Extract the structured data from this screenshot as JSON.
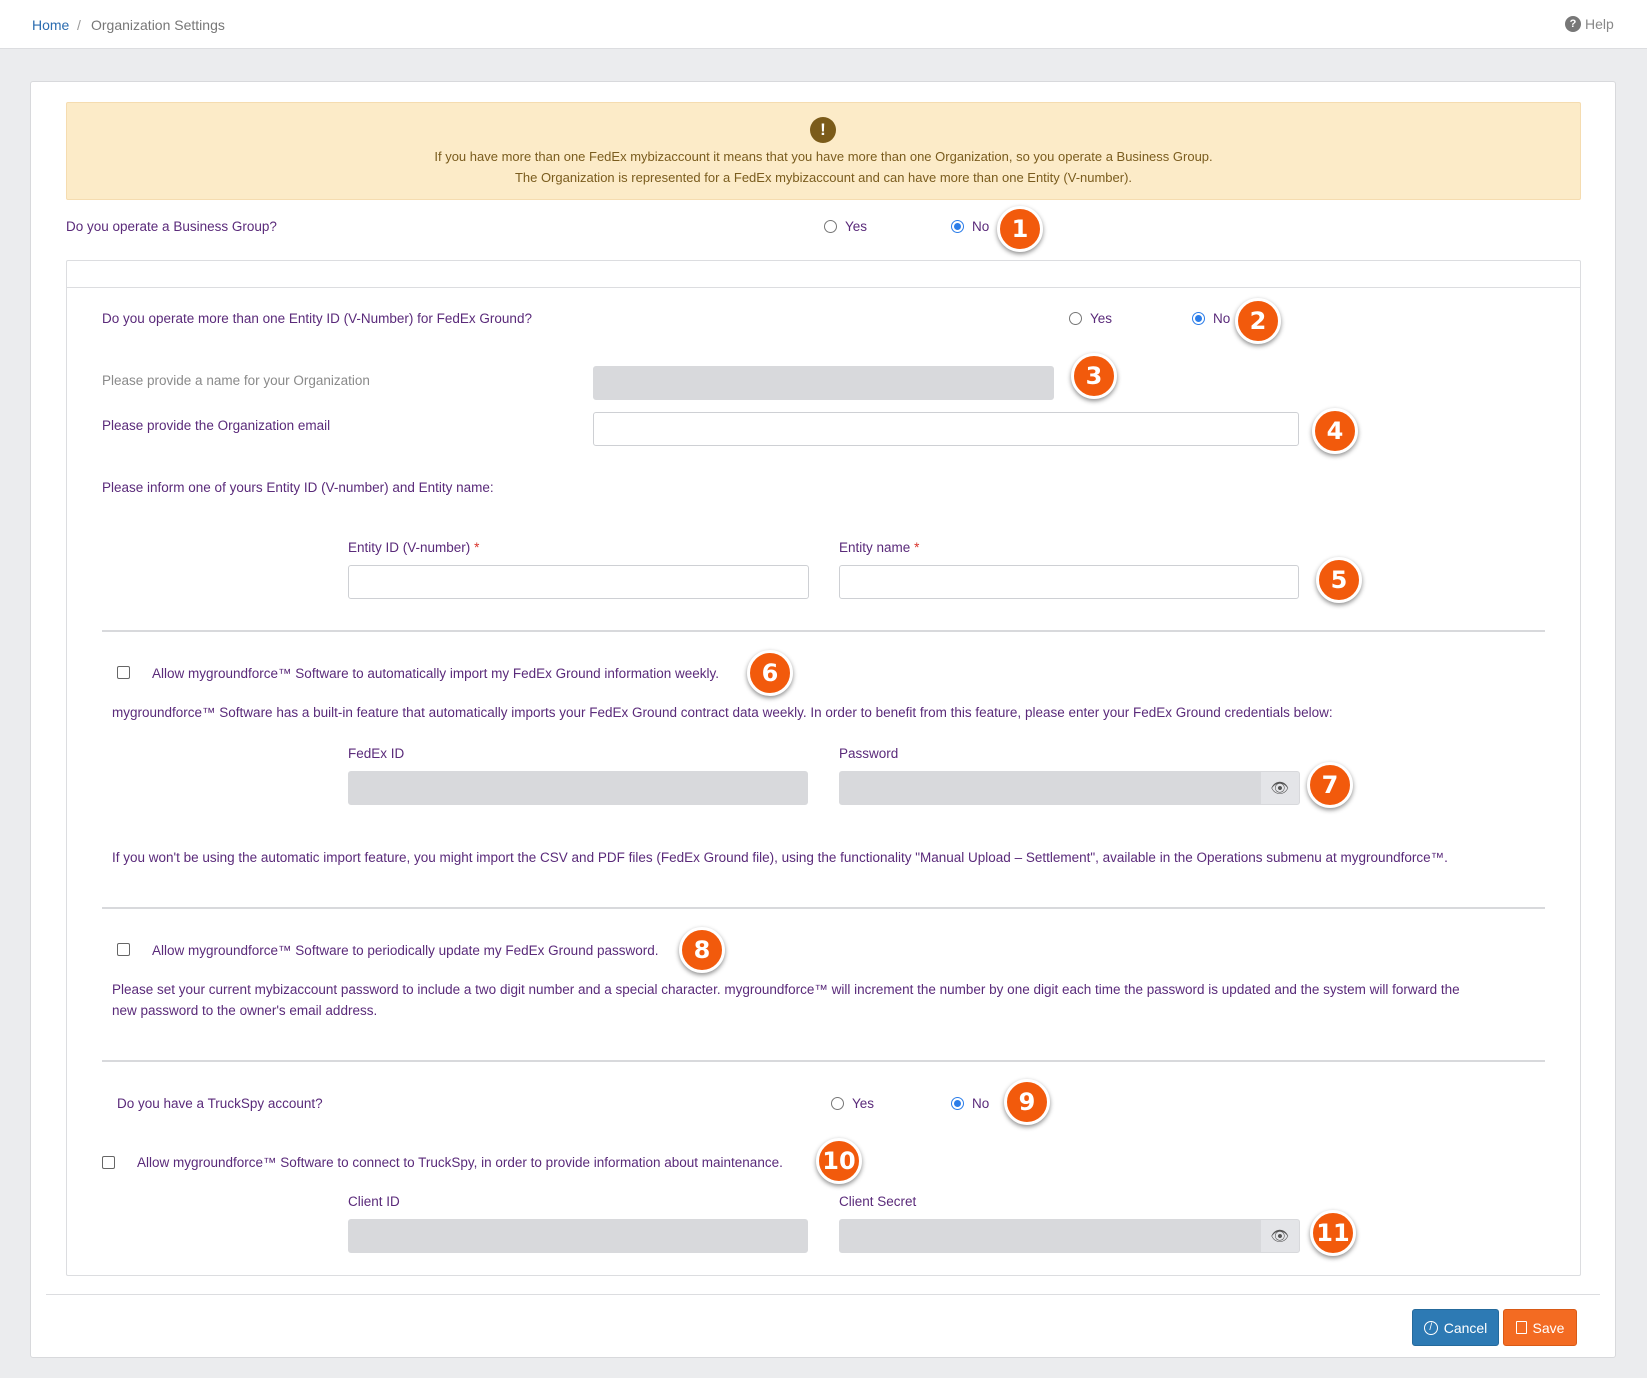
{
  "breadcrumb": {
    "home": "Home",
    "separator": "/",
    "current": "Organization Settings"
  },
  "help": {
    "label": "Help",
    "icon": "question-circle-icon"
  },
  "alert": {
    "icon": "exclamation-circle-icon",
    "line1": "If you have more than one FedEx mybizaccount it means that you have more than one Organization, so you operate a Business Group.",
    "line2": "The Organization is represented for a FedEx mybizaccount and can have more than one Entity (V-number)."
  },
  "business_group": {
    "question": "Do you operate a Business Group?",
    "yes": "Yes",
    "no": "No",
    "selected": "No"
  },
  "entity_question": {
    "question": "Do you operate more than one Entity ID (V-Number) for FedEx Ground?",
    "yes": "Yes",
    "no": "No",
    "selected": "No"
  },
  "org_name": {
    "label": "Please provide a name for your Organization",
    "value": ""
  },
  "org_email": {
    "label": "Please provide the Organization email",
    "value": ""
  },
  "entity_info": {
    "intro": "Please inform one of yours Entity ID (V-number) and Entity name:",
    "id_label": "Entity ID (V-number)",
    "name_label": "Entity name",
    "required_mark": "*"
  },
  "auto_import": {
    "checkbox_label": "Allow mygroundforce™ Software to automatically import my FedEx Ground information weekly.",
    "description": "mygroundforce™ Software has a built-in feature that automatically imports your FedEx Ground contract data weekly. In order to benefit from this feature, please enter your FedEx Ground credentials below:",
    "fedex_id_label": "FedEx ID",
    "password_label": "Password",
    "manual_note": "If you won't be using the automatic import feature, you might import the CSV and PDF files (FedEx Ground file), using the functionality \"Manual Upload – Settlement\", available in the Operations submenu at mygroundforce™."
  },
  "password_update": {
    "checkbox_label": "Allow mygroundforce™ Software to periodically update my FedEx Ground password.",
    "description_line1": "Please set your current mybizaccount password to include a two digit number and a special character. mygroundforce™ will increment the number by one digit each time the password is updated and the system will forward the",
    "description_line2": "new password to the owner's email address."
  },
  "truckspy": {
    "question": "Do you have a TruckSpy account?",
    "yes": "Yes",
    "no": "No",
    "selected": "No",
    "checkbox_label": "Allow mygroundforce™ Software to connect to TruckSpy, in order to provide information about maintenance.",
    "client_id_label": "Client ID",
    "client_secret_label": "Client Secret"
  },
  "badges": [
    "1",
    "2",
    "3",
    "4",
    "5",
    "6",
    "7",
    "8",
    "9",
    "10",
    "11"
  ],
  "footer": {
    "cancel": "Cancel",
    "save": "Save"
  },
  "colors": {
    "accent": "#f25a0c",
    "primary": "#2d7ab4",
    "save": "#f36b22",
    "alert_bg": "#fcebc8",
    "label": "#5a2a7a"
  }
}
